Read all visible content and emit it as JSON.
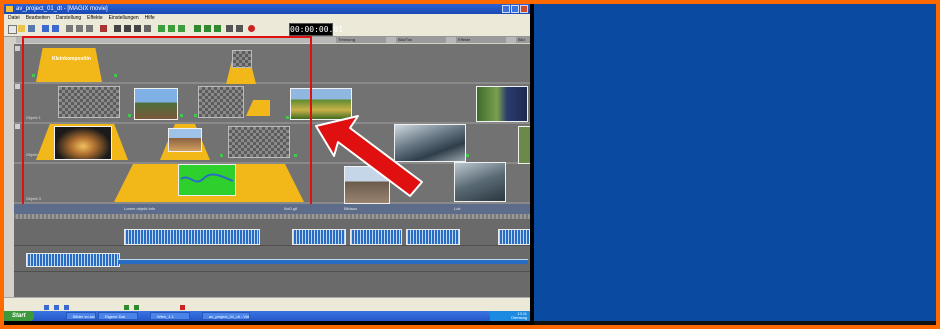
{
  "window": {
    "title": "av_project_01_dt - [MAGIX movie]"
  },
  "menu": [
    "Datei",
    "Bearbeiten",
    "Darstellung",
    "Effekte",
    "Einstellungen",
    "Hilfe"
  ],
  "timecode": "00:00:00.01",
  "track_headers": [
    "Trennung",
    "Bild/Ton",
    "Effekte",
    "Bild"
  ],
  "overlay_title_text": "Kleinkompositin",
  "lanes": [
    "Objekt 1",
    "Objekt 2",
    "Objekt 3"
  ],
  "separator_labels": [
    "Lorem objekt-Info",
    "NoD.gif",
    "Bildaus",
    "Lok"
  ],
  "taskbar": {
    "start_label": "Start",
    "buttons": [
      "Bilder vo sichtbarte",
      "Eigene Dat",
      "Wien_1.1",
      "av_project_01_dt - Video"
    ],
    "clock_line1": "13:11",
    "clock_line2": "Dienstag",
    "clock_line3": "05.09.2006"
  },
  "colors": {
    "annotation": "#e01010",
    "desktop_right": "#0a4aa0",
    "border": "#ff6a00",
    "track_yellow": "#f2b81a",
    "audio_wave": "#2a6cc4"
  },
  "icons": {
    "arrow": "arrow-icon",
    "play": "play-icon",
    "stop": "stop-icon",
    "record": "record-icon"
  }
}
